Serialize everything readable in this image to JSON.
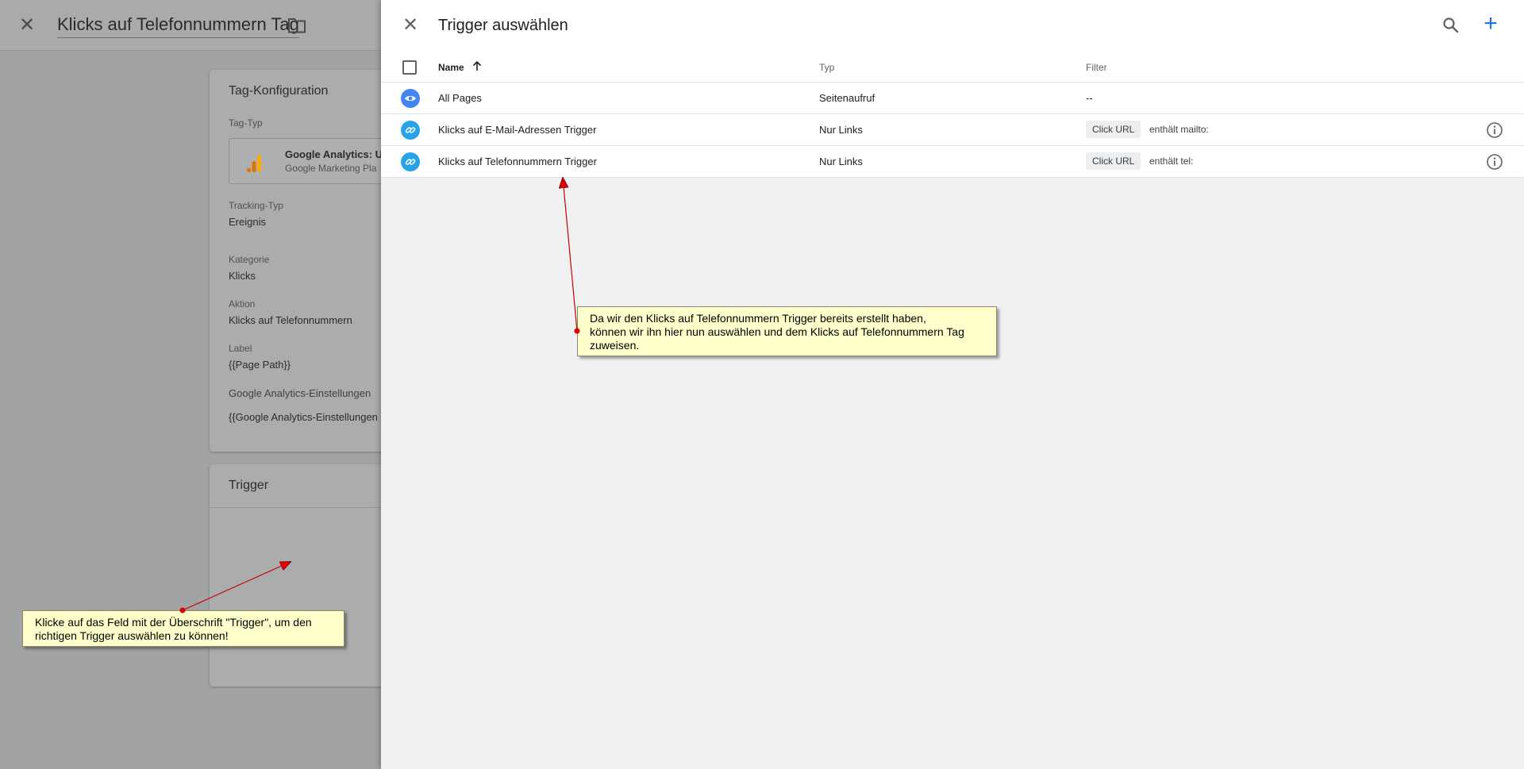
{
  "background": {
    "title": "Klicks auf Telefonnummern Tag",
    "config_card": {
      "title": "Tag-Konfiguration",
      "tag_type_label": "Tag-Typ",
      "tag_type_name": "Google Analytics: Ur",
      "tag_type_sub": "Google Marketing Pla",
      "tracking_type_label": "Tracking-Typ",
      "tracking_type_value": "Ereignis",
      "category_label": "Kategorie",
      "category_value": "Klicks",
      "action_label": "Aktion",
      "action_value": "Klicks auf Telefonnummern",
      "label_label": "Label",
      "label_value": "{{Page Path}}",
      "ga_settings_label": "Google Analytics-Einstellungen",
      "ga_settings_value": "{{Google Analytics-Einstellungen"
    },
    "trigger_card": {
      "title": "Trigger"
    }
  },
  "panel": {
    "title": "Trigger auswählen",
    "columns": {
      "name": "Name",
      "type": "Typ",
      "filter": "Filter"
    },
    "rows": [
      {
        "name": "All Pages",
        "type": "Seitenaufruf",
        "filter": "--",
        "icon": "eye-icon"
      },
      {
        "name": "Klicks auf E-Mail-Adressen Trigger",
        "type": "Nur Links",
        "chip": "Click URL",
        "condition": "enthält mailto:",
        "icon": "link-icon"
      },
      {
        "name": "Klicks auf Telefonnummern Trigger",
        "type": "Nur Links",
        "chip": "Click URL",
        "condition": "enthält tel:",
        "icon": "link-icon"
      }
    ]
  },
  "annotations": {
    "note1": [
      "Da wir den Klicks auf Telefonnummern Trigger bereits erstellt haben,",
      "können wir ihn hier nun auswählen und dem Klicks auf Telefonnummern Tag",
      "zuweisen."
    ],
    "note2": [
      "Klicke auf das Feld mit der Überschrift \"Trigger\", um den",
      "richtigen Trigger auswählen zu können!"
    ]
  },
  "colors": {
    "accent": "#1a73e8",
    "trigger_view": "#4285f4",
    "trigger_link": "#29a3e8",
    "note_bg": "#ffffcc",
    "arrow": "#e00000"
  }
}
